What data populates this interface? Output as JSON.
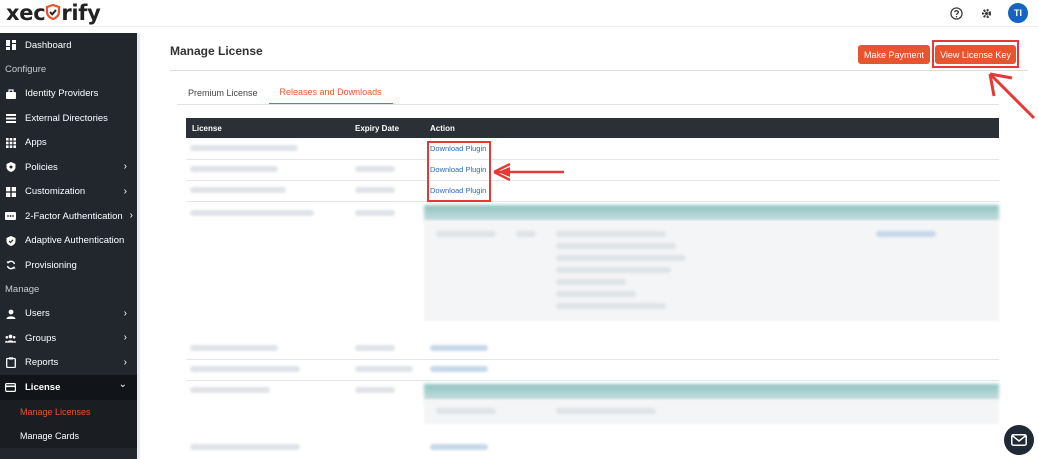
{
  "brand": {
    "logo_text_left": "xec",
    "logo_text_right": "rify"
  },
  "header": {
    "avatar_initials": "TI"
  },
  "sidebar": {
    "items": [
      {
        "type": "item",
        "label": "Dashboard",
        "icon": "dashboard-icon"
      },
      {
        "type": "section",
        "label": "Configure"
      },
      {
        "type": "item",
        "label": "Identity Providers",
        "icon": "briefcase-icon"
      },
      {
        "type": "item",
        "label": "External Directories",
        "icon": "list-icon"
      },
      {
        "type": "item",
        "label": "Apps",
        "icon": "grid-icon"
      },
      {
        "type": "item",
        "label": "Policies",
        "icon": "shield-icon",
        "chevron": true
      },
      {
        "type": "item",
        "label": "Customization",
        "icon": "widgets-icon",
        "chevron": true
      },
      {
        "type": "item",
        "label": "2-Factor Authentication",
        "icon": "keypad-icon",
        "chevron": true
      },
      {
        "type": "item",
        "label": "Adaptive Authentication",
        "icon": "shield-check-icon"
      },
      {
        "type": "item",
        "label": "Provisioning",
        "icon": "sync-icon"
      },
      {
        "type": "section",
        "label": "Manage"
      },
      {
        "type": "item",
        "label": "Users",
        "icon": "user-icon",
        "chevron": true
      },
      {
        "type": "item",
        "label": "Groups",
        "icon": "group-icon",
        "chevron": true
      },
      {
        "type": "item",
        "label": "Reports",
        "icon": "clipboard-icon",
        "chevron": true
      },
      {
        "type": "item",
        "label": "License",
        "icon": "card-icon",
        "chevron": true,
        "expanded": true
      },
      {
        "type": "sub",
        "label": "Manage Licenses",
        "current": true
      },
      {
        "type": "sub",
        "label": "Manage Cards"
      }
    ]
  },
  "main": {
    "title": "Manage License",
    "buttons": {
      "make_payment": "Make Payment",
      "view_license_key": "View License Key"
    },
    "tabs": [
      {
        "label": "Premium License"
      },
      {
        "label": "Releases and Downloads",
        "active": true
      }
    ],
    "table": {
      "headers": [
        "License",
        "Expiry Date",
        "Action"
      ],
      "actions": [
        "Download Plugin",
        "Download Plugin",
        "Download Plugin"
      ]
    }
  },
  "colors": {
    "accent": "#e8542d",
    "sidebar_bg": "#22272e",
    "highlight": "#e53935",
    "link": "#2d6bb8"
  }
}
